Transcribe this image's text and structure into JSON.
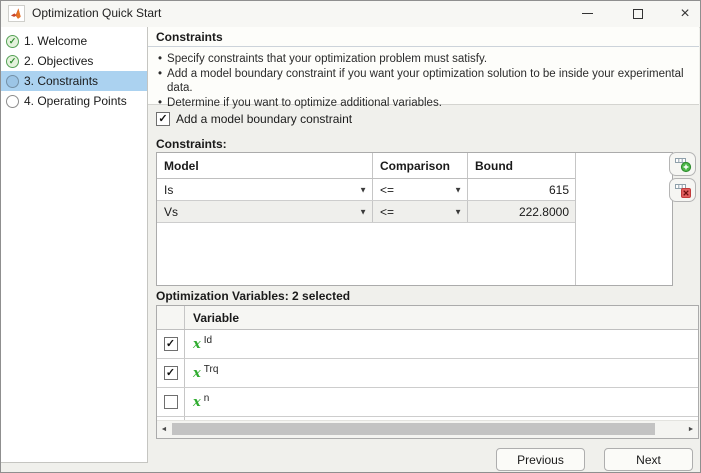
{
  "window": {
    "title": "Optimization Quick Start"
  },
  "icons": {
    "check": "✓",
    "dropdown": "▼",
    "bullet": "•",
    "scroll_left": "◄",
    "scroll_right": "►",
    "close": "×"
  },
  "sidebar": {
    "steps": [
      {
        "label": "1. Welcome",
        "status": "complete",
        "mark": "✓"
      },
      {
        "label": "2. Objectives",
        "status": "complete",
        "mark": "✓"
      },
      {
        "label": "3. Constraints",
        "status": "current",
        "mark": ""
      },
      {
        "label": "4. Operating Points",
        "status": "pending",
        "mark": ""
      }
    ]
  },
  "header": {
    "title": "Constraints",
    "bullets": [
      "Specify constraints that your optimization problem must satisfy.",
      "Add a model boundary constraint if you want your optimization solution to be inside your experimental data.",
      "Determine if you want to optimize additional variables."
    ]
  },
  "main": {
    "boundary_checkbox": {
      "label": "Add a model boundary constraint",
      "checked": true,
      "mark": "✓"
    },
    "constraints": {
      "label": "Constraints:",
      "columns": [
        "Model",
        "Comparison",
        "Bound"
      ],
      "rows": [
        {
          "model": "Is",
          "comparison": "<=",
          "bound": "615"
        },
        {
          "model": "Vs",
          "comparison": "<=",
          "bound": "222.8000"
        }
      ]
    },
    "variables": {
      "label": "Optimization Variables: 2 selected",
      "column_header": "Variable",
      "symbol": "x",
      "rows": [
        {
          "name": "Id",
          "checked": true,
          "mark": "✓"
        },
        {
          "name": "Trq",
          "checked": true,
          "mark": "✓"
        },
        {
          "name": "n",
          "checked": false,
          "mark": ""
        }
      ]
    },
    "buttons": {
      "previous": "Previous",
      "next": "Next"
    }
  },
  "colors": {
    "selection_blue": "#abd2f0",
    "complete_green": "#57a257",
    "variable_green": "#2fac2f",
    "add_green": "#4db848",
    "delete_red": "#e25f5f"
  }
}
